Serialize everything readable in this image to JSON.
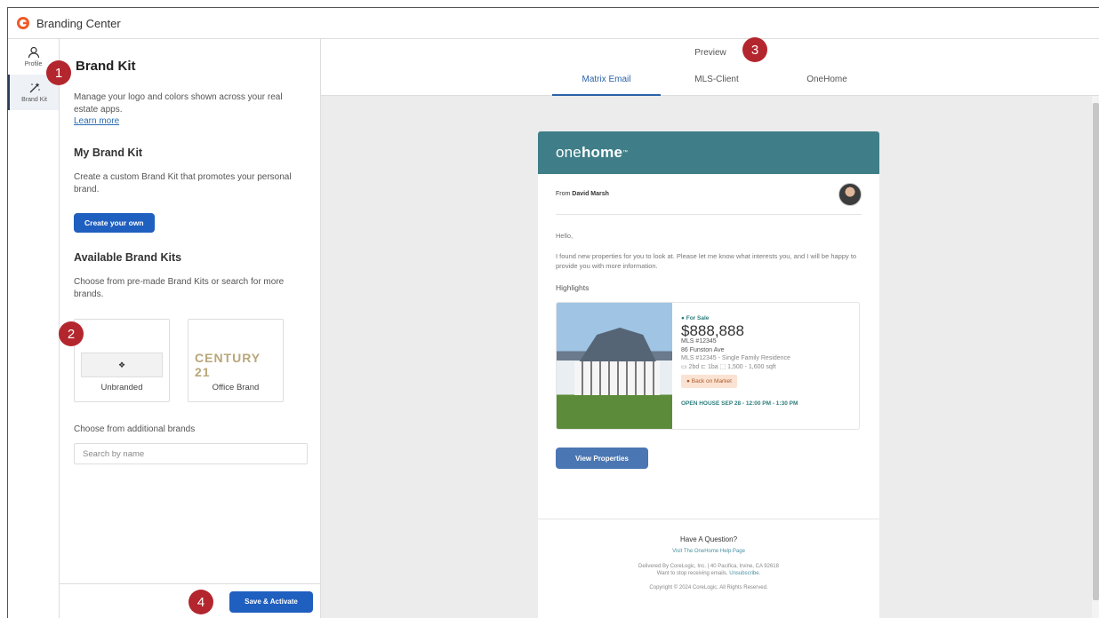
{
  "app": {
    "title": "Branding Center"
  },
  "rail": [
    {
      "label": "Profile",
      "icon": "user-icon"
    },
    {
      "label": "Brand Kit",
      "icon": "magic-wand-icon"
    }
  ],
  "panel": {
    "title": "Brand Kit",
    "description": "Manage your logo and colors shown across your real estate apps.",
    "learn_more": "Learn more",
    "my_kit": {
      "heading": "My Brand Kit",
      "description": "Create a custom Brand Kit that promotes your personal brand.",
      "button": "Create your own"
    },
    "available": {
      "heading": "Available Brand Kits",
      "description": "Choose from pre-made Brand Kits or search for more brands.",
      "kits": [
        {
          "name": "Unbranded",
          "logo": "❖"
        },
        {
          "name": "Office Brand",
          "logo": "CENTURY 21"
        }
      ],
      "additional_label": "Choose from additional brands",
      "search_placeholder": "Search by name"
    },
    "save_button": "Save & Activate"
  },
  "preview": {
    "label": "Preview",
    "tabs": [
      "Matrix Email",
      "MLS-Client",
      "OneHome"
    ],
    "active_tab": "Matrix Email"
  },
  "email": {
    "brand_pre": "one",
    "brand_bold": "home",
    "brand_mark": "™",
    "from_label": "From",
    "from_name": "David Marsh",
    "greeting": "Hello,",
    "message": "I found new properties for you to look at. Please let me know what interests you, and I will be happy to provide you with more information.",
    "highlights": "Highlights",
    "listing": {
      "status": "● For Sale",
      "price": "$888,888",
      "mls": "MLS #12345",
      "address": "86 Funston Ave",
      "detail": "MLS #12345 - Single Family Residence",
      "specs": "▭ 2bd   ⊏ 1ba   ⬚ 1,500 - 1,600 sqft",
      "badge": "● Back on Market",
      "open_house": "OPEN HOUSE SEP 28 - 12:00 PM - 1:30 PM"
    },
    "view_button": "View Properties",
    "footer": {
      "question": "Have A Question?",
      "help_link": "Visit The OneHome Help Page",
      "delivered": "Delivered By CoreLogic, Inc. | 40 Pacifica, Irvine, CA 92618",
      "stop": "Want to stop receiving emails.",
      "unsubscribe": "Unsubscribe.",
      "copyright": "Copyright © 2024 CoreLogic. All Rights Reserved."
    }
  },
  "steps": [
    "1",
    "2",
    "3",
    "4"
  ],
  "colors": {
    "primary": "#1f5fbf",
    "brand_bar": "#3f7e88",
    "step_marker": "#b3262e"
  }
}
